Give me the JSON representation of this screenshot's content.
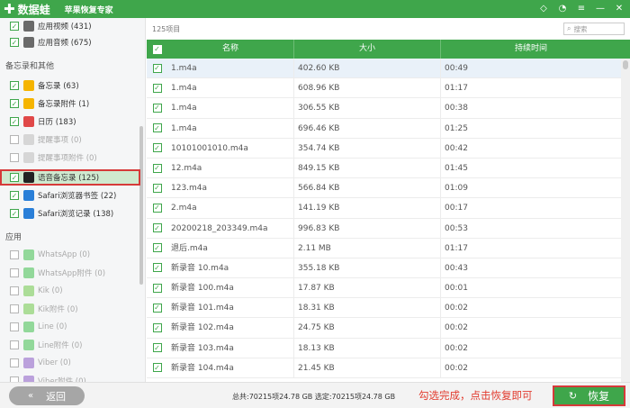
{
  "app": {
    "brand": "数据蛙",
    "product": "苹果恢复专家"
  },
  "window_controls": [
    {
      "name": "diamond-icon",
      "glyph": "◇"
    },
    {
      "name": "chat-icon",
      "glyph": "◔"
    },
    {
      "name": "menu-icon",
      "glyph": "≡"
    },
    {
      "name": "minimize-icon",
      "glyph": "—"
    },
    {
      "name": "close-icon",
      "glyph": "✕"
    }
  ],
  "sidebar": {
    "section_notes": "备忘录和其他",
    "section_apps": "应用",
    "items": [
      {
        "label": "应用视频 (431)",
        "checked": true,
        "disabled": false,
        "icon": "video-icon",
        "color": "#6a6a6a"
      },
      {
        "label": "应用音频 (675)",
        "checked": true,
        "disabled": false,
        "icon": "music-icon",
        "color": "#6a6a6a"
      },
      {
        "label": "备忘录 (63)",
        "checked": true,
        "disabled": false,
        "icon": "notes-icon",
        "color": "#f5b400"
      },
      {
        "label": "备忘录附件 (1)",
        "checked": true,
        "disabled": false,
        "icon": "notes-attachment-icon",
        "color": "#f5b400"
      },
      {
        "label": "日历 (183)",
        "checked": true,
        "disabled": false,
        "icon": "calendar-icon",
        "color": "#e04848"
      },
      {
        "label": "提醒事项 (0)",
        "checked": false,
        "disabled": true,
        "icon": "reminders-icon",
        "color": "#bbbbbb"
      },
      {
        "label": "提醒事项附件 (0)",
        "checked": false,
        "disabled": true,
        "icon": "reminders-attachment-icon",
        "color": "#bbbbbb"
      },
      {
        "label": "语音备忘录 (125)",
        "checked": true,
        "disabled": false,
        "selected": true,
        "icon": "voice-memo-icon",
        "color": "#222222"
      },
      {
        "label": "Safari浏览器书签 (22)",
        "checked": true,
        "disabled": false,
        "icon": "bookmark-icon",
        "color": "#2a7fd8"
      },
      {
        "label": "Safari浏览记录 (138)",
        "checked": true,
        "disabled": false,
        "icon": "safari-icon",
        "color": "#2a7fd8"
      },
      {
        "label": "WhatsApp (0)",
        "checked": false,
        "disabled": true,
        "icon": "whatsapp-icon",
        "color": "#3fc04e"
      },
      {
        "label": "WhatsApp附件 (0)",
        "checked": false,
        "disabled": true,
        "icon": "whatsapp-attachment-icon",
        "color": "#3fc04e"
      },
      {
        "label": "Kik (0)",
        "checked": false,
        "disabled": true,
        "icon": "kik-icon",
        "color": "#6fc94a"
      },
      {
        "label": "Kik附件 (0)",
        "checked": false,
        "disabled": true,
        "icon": "kik-attachment-icon",
        "color": "#6fc94a"
      },
      {
        "label": "Line (0)",
        "checked": false,
        "disabled": true,
        "icon": "line-icon",
        "color": "#3fc04e"
      },
      {
        "label": "Line附件 (0)",
        "checked": false,
        "disabled": true,
        "icon": "line-attachment-icon",
        "color": "#3fc04e"
      },
      {
        "label": "Viber (0)",
        "checked": false,
        "disabled": true,
        "icon": "viber-icon",
        "color": "#8a5bc7"
      },
      {
        "label": "Viber附件 (0)",
        "checked": false,
        "disabled": true,
        "icon": "viber-attachment-icon",
        "color": "#8a5bc7"
      }
    ]
  },
  "main": {
    "item_count": "125项目",
    "search_placeholder": "搜索",
    "columns": {
      "name": "名称",
      "size": "大小",
      "duration": "持续时间"
    },
    "rows": [
      {
        "name": "1.m4a",
        "size": "402.60 KB",
        "duration": "00:49"
      },
      {
        "name": "1.m4a",
        "size": "608.96 KB",
        "duration": "01:17"
      },
      {
        "name": "1.m4a",
        "size": "306.55 KB",
        "duration": "00:38"
      },
      {
        "name": "1.m4a",
        "size": "696.46 KB",
        "duration": "01:25"
      },
      {
        "name": "10101001010.m4a",
        "size": "354.74 KB",
        "duration": "00:42"
      },
      {
        "name": "12.m4a",
        "size": "849.15 KB",
        "duration": "01:45"
      },
      {
        "name": "123.m4a",
        "size": "566.84 KB",
        "duration": "01:09"
      },
      {
        "name": "2.m4a",
        "size": "141.19 KB",
        "duration": "00:17"
      },
      {
        "name": "20200218_203349.m4a",
        "size": "996.83 KB",
        "duration": "00:53"
      },
      {
        "name": "退后.m4a",
        "size": "2.11 MB",
        "duration": "01:17"
      },
      {
        "name": "新录音 10.m4a",
        "size": "355.18 KB",
        "duration": "00:43"
      },
      {
        "name": "新录音 100.m4a",
        "size": "17.87 KB",
        "duration": "00:01"
      },
      {
        "name": "新录音 101.m4a",
        "size": "18.31 KB",
        "duration": "00:02"
      },
      {
        "name": "新录音 102.m4a",
        "size": "24.75 KB",
        "duration": "00:02"
      },
      {
        "name": "新录音 103.m4a",
        "size": "18.13 KB",
        "duration": "00:02"
      },
      {
        "name": "新录音 104.m4a",
        "size": "21.45 KB",
        "duration": "00:02"
      }
    ]
  },
  "footer": {
    "back_label": "返回",
    "totals": "总共:70215项24.78 GB 选定:70215项24.78 GB",
    "hint": "勾选完成，点击恢复即可",
    "recover_label": "恢复"
  },
  "colors": {
    "brand_green": "#3fa64b",
    "highlight_red": "#d63a3a",
    "hint_red": "#e23b2e"
  }
}
